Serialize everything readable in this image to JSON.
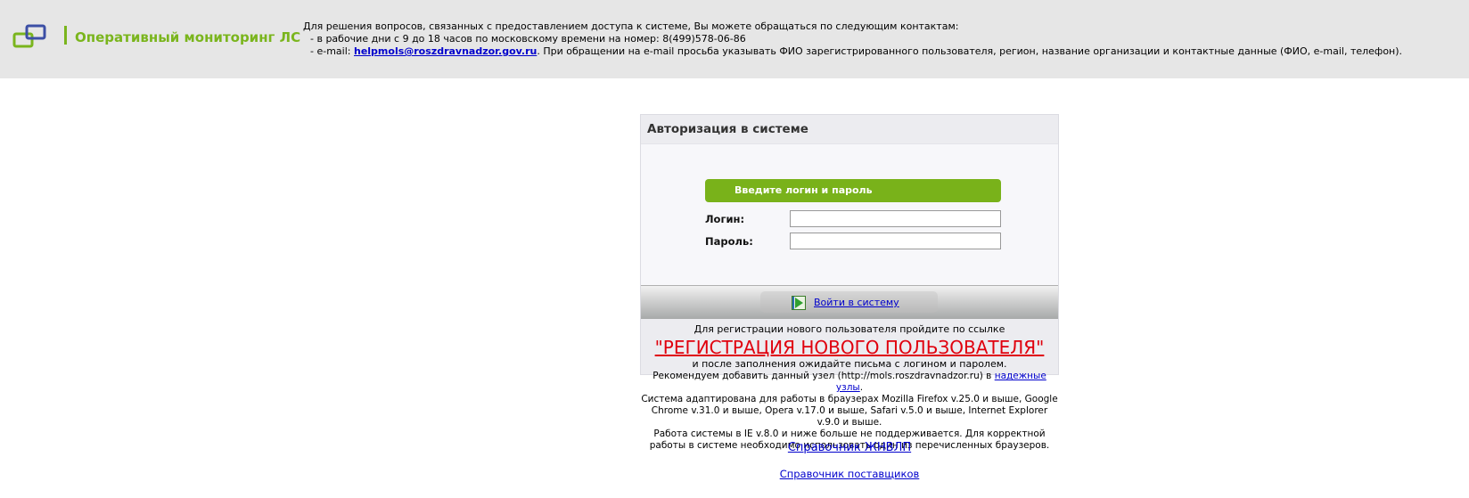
{
  "header": {
    "logo_text": "Оперативный мониторинг ЛС",
    "contact_intro": "Для решения вопросов, связанных с предоставлением доступа к системе, Вы можете обращаться по следующим контактам:",
    "contact_phone": "- в рабочие дни с 9 до 18 часов по московскому времени на номер: 8(499)578-06-86",
    "contact_email_prefix": "- e-mail: ",
    "contact_email": "helpmols@roszdravnadzor.gov.ru",
    "contact_email_suffix": ". При обращении на e-mail просьба указывать ФИО зарегистрированного пользователя, регион, название организации и контактные данные (ФИО, e-mail, телефон)."
  },
  "auth": {
    "title": "Авторизация в системе",
    "banner": "Введите логин и пароль",
    "login_label": "Логин:",
    "login_value": "",
    "password_label": "Пароль:",
    "password_value": "",
    "submit_label": "Войти в систему"
  },
  "registration": {
    "intro": "Для регистрации нового пользователя пройдите по ссылке",
    "link": "\"РЕГИСТРАЦИЯ НОВОГО ПОЛЬЗОВАТЕЛЯ\"",
    "outro": "и после заполнения ожидайте письма с логином и паролем."
  },
  "notes": {
    "recommend_prefix": "Рекомендуем добавить данный узел (http://mols.roszdravnadzor.ru) в ",
    "trusted_link": "надежные узлы",
    "recommend_suffix": ".",
    "browsers": "Система адаптирована для работы в браузерах Mozilla Firefox v.25.0 и выше, Google Chrome v.31.0 и выше, Opera v.17.0 и выше, Safari v.5.0 и выше, Internet Explorer v.9.0 и выше.",
    "ie_warning": "Работа системы в IE v.8.0 и ниже больше не поддерживается. Для корректной работы в системе необходимо использовать один из перечисленных браузеров."
  },
  "links": {
    "jnvlp": "Справочник ЖНВЛП",
    "suppliers": "Справочник поставщиков"
  },
  "colors": {
    "brand_green": "#7ab51d",
    "header_bg": "#e6e6e6",
    "registration_red": "#e0000d",
    "link_blue": "#0000cc"
  },
  "icons": {
    "logo": "linked-squares-logo-icon",
    "login": "login-arrow-icon"
  }
}
